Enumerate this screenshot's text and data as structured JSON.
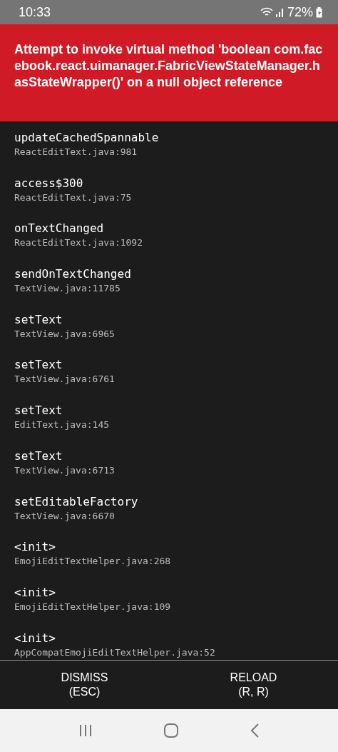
{
  "status_bar": {
    "time": "10:33",
    "battery": "72%"
  },
  "error": {
    "message": "Attempt to invoke virtual method 'boolean com.facebook.react.uimanager.FabricViewStateManager.hasStateWrapper()' on a null object reference"
  },
  "stack": [
    {
      "method": "updateCachedSpannable",
      "file": "ReactEditText.java:981"
    },
    {
      "method": "access$300",
      "file": "ReactEditText.java:75"
    },
    {
      "method": "onTextChanged",
      "file": "ReactEditText.java:1092"
    },
    {
      "method": "sendOnTextChanged",
      "file": "TextView.java:11785"
    },
    {
      "method": "setText",
      "file": "TextView.java:6965"
    },
    {
      "method": "setText",
      "file": "TextView.java:6761"
    },
    {
      "method": "setText",
      "file": "EditText.java:145"
    },
    {
      "method": "setText",
      "file": "TextView.java:6713"
    },
    {
      "method": "setEditableFactory",
      "file": "TextView.java:6670"
    },
    {
      "method": "<init>",
      "file": "EmojiEditTextHelper.java:268"
    },
    {
      "method": "<init>",
      "file": "EmojiEditTextHelper.java:109"
    },
    {
      "method": "<init>",
      "file": "AppCompatEmojiEditTextHelper.java:52"
    }
  ],
  "buttons": [
    {
      "label": "DISMISS",
      "shortcut": "(ESC)"
    },
    {
      "label": "RELOAD",
      "shortcut": "(R, R)"
    }
  ]
}
